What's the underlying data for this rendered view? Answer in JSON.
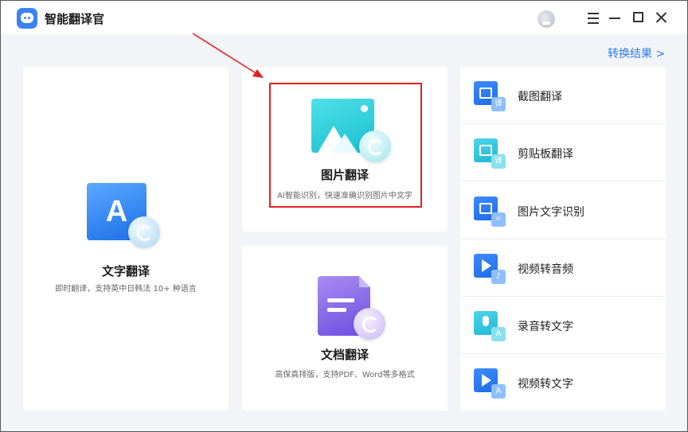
{
  "app": {
    "title": "智能翻译官"
  },
  "header": {
    "result_link": "转换结果 >"
  },
  "cards": {
    "text": {
      "title": "文字翻译",
      "desc": "即时翻译，支持英中日韩法 10+ 种语言",
      "icon": "A"
    },
    "image": {
      "title": "图片翻译",
      "desc": "AI智能识别，快速准确识别图片中文字"
    },
    "doc": {
      "title": "文档翻译",
      "desc": "高保真排版，支持PDF、Word等多格式"
    }
  },
  "tools": [
    {
      "label": "截图翻译",
      "icon": "screenshot-translate-icon",
      "mini": "译"
    },
    {
      "label": "剪贴板翻译",
      "icon": "clipboard-translate-icon",
      "mini": "译"
    },
    {
      "label": "图片文字识别",
      "icon": "image-ocr-icon",
      "mini": "⌗"
    },
    {
      "label": "视频转音频",
      "icon": "video-to-audio-icon",
      "mini": "♪"
    },
    {
      "label": "录音转文字",
      "icon": "audio-to-text-icon",
      "mini": "A"
    },
    {
      "label": "视频转文字",
      "icon": "video-to-text-icon",
      "mini": "A"
    }
  ],
  "colors": {
    "accent": "#2f7be8",
    "highlight": "#e02020",
    "background": "#f3f4f7"
  }
}
